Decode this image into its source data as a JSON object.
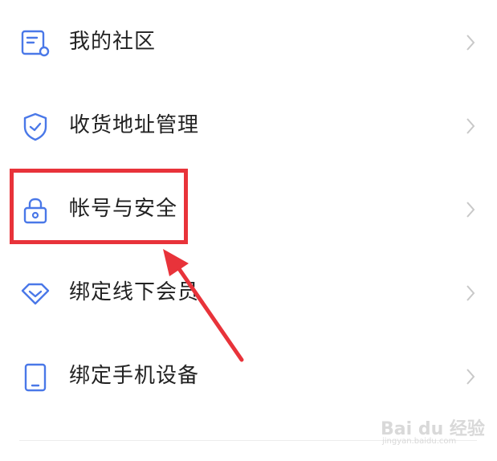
{
  "menu": {
    "items": [
      {
        "label": "我的社区",
        "icon": "community-doc-icon"
      },
      {
        "label": "收货地址管理",
        "icon": "shield-check-icon"
      },
      {
        "label": "帐号与安全",
        "icon": "lock-icon"
      },
      {
        "label": "绑定线下会员",
        "icon": "diamond-icon"
      },
      {
        "label": "绑定手机设备",
        "icon": "phone-icon"
      }
    ]
  },
  "annotation": {
    "highlight_color": "#e8333a",
    "highlighted_item": "帐号与安全"
  },
  "colors": {
    "icon_blue": "#4a78e8",
    "text": "#222222",
    "chevron": "#c8c8c8"
  },
  "watermark": {
    "main": "Bai du 经验",
    "sub": "jingyan.baidu.com"
  }
}
